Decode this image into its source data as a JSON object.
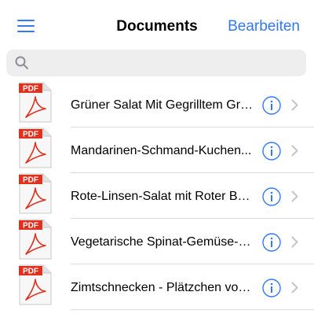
{
  "header": {
    "title": "Documents",
    "edit_label": "Bearbeiten"
  },
  "search": {
    "placeholder": ""
  },
  "documents": [
    {
      "title": "Grüner Salat Mit Gegrilltem Grü...",
      "badge": "PDF"
    },
    {
      "title": "Mandarinen-Schmand-Kuchen...",
      "badge": "PDF"
    },
    {
      "title": "Rote-Linsen-Salat mit Roter Bet...",
      "badge": "PDF"
    },
    {
      "title": "Vegetarische Spinat-Gemüse-L...",
      "badge": "PDF"
    },
    {
      "title": "Zimtschnecken - Plätzchen von...",
      "badge": "PDF"
    }
  ],
  "colors": {
    "accent": "#3478f6",
    "pdf_red": "#e0301e",
    "separator": "#dadadc",
    "search_bg": "#eeeeef"
  },
  "icons": [
    "menu-icon",
    "search-icon",
    "pdf-file-icon",
    "info-icon",
    "chevron-right-icon"
  ]
}
